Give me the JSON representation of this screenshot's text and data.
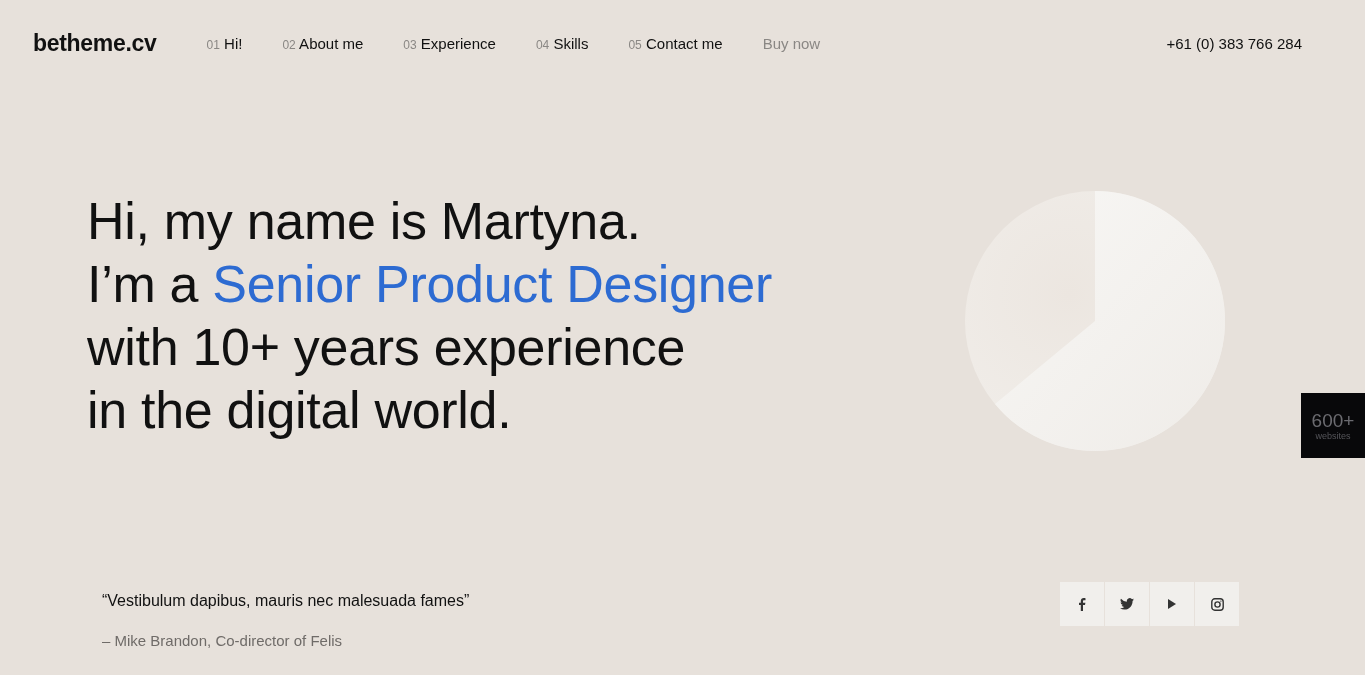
{
  "logo": "betheme.cv",
  "nav": [
    {
      "number": "01",
      "label": "Hi!",
      "kind": "section"
    },
    {
      "number": "02",
      "label": "About me",
      "kind": "section"
    },
    {
      "number": "03",
      "label": "Experience",
      "kind": "section"
    },
    {
      "number": "04",
      "label": "Skills",
      "kind": "section"
    },
    {
      "number": "05",
      "label": "Contact me",
      "kind": "section"
    },
    {
      "label": "Buy now",
      "kind": "link"
    }
  ],
  "phone": "+61 (0) 383 766 284",
  "headline": [
    {
      "text": "Hi, my name is Martyna."
    },
    {
      "text": "I’m a ",
      "highlight": "Senior Product Designer"
    },
    {
      "text": "with 10+ years experience"
    },
    {
      "text": "in the digital world."
    }
  ],
  "quote": "“Vestibulum dapibus, mauris nec malesuada fames”",
  "author": "– Mike Brandon, Co-director of Felis",
  "social": [
    {
      "kind": "facebook"
    },
    {
      "kind": "twitter"
    },
    {
      "kind": "youtube"
    },
    {
      "kind": "instagram"
    }
  ],
  "badge": {
    "count": "600+",
    "label": "websites"
  }
}
